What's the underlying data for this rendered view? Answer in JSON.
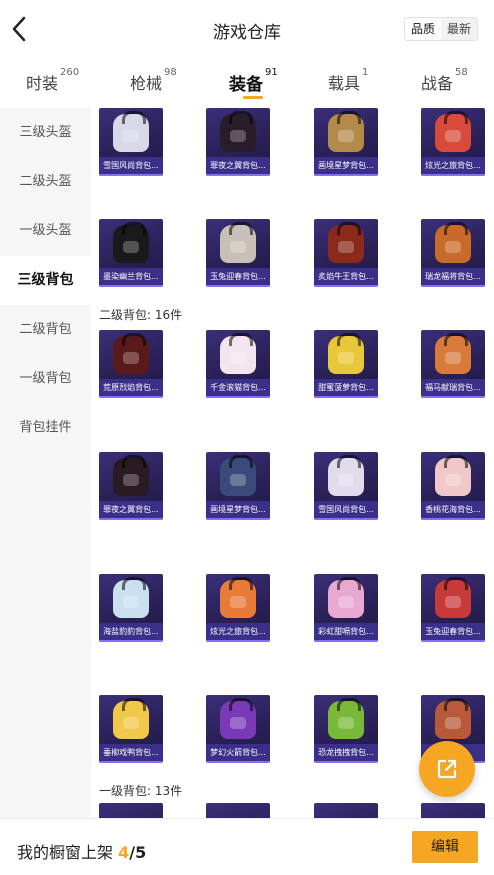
{
  "header": {
    "title": "游戏仓库",
    "sort_options": [
      "品质",
      "最新"
    ],
    "sort_active": "品质"
  },
  "tabs": [
    {
      "label": "时装",
      "count": "260"
    },
    {
      "label": "枪械",
      "count": "98"
    },
    {
      "label": "装备",
      "count": "91",
      "active": true
    },
    {
      "label": "载具",
      "count": "1"
    },
    {
      "label": "战备",
      "count": "58"
    }
  ],
  "sidebar": {
    "items": [
      {
        "label": "三级头盔"
      },
      {
        "label": "二级头盔"
      },
      {
        "label": "一级头盔"
      },
      {
        "label": "三级背包",
        "active": true
      },
      {
        "label": "二级背包"
      },
      {
        "label": "一级背包"
      },
      {
        "label": "背包挂件"
      }
    ]
  },
  "sections": {
    "level2_label": "二级背包: 16件",
    "level1_label": "一级背包: 13件"
  },
  "items_level3": [
    {
      "name": "雪国风尚背包...",
      "color": "#d8d8e8"
    },
    {
      "name": "罪夜之翼背包...",
      "color": "#2a1d2a"
    },
    {
      "name": "画境星梦背包...",
      "color": "#b48a4a"
    },
    {
      "name": "炫光之旅背包...",
      "color": "#d84a3a"
    },
    {
      "name": "墨染幽兰背包...",
      "color": "#1a1a1a"
    },
    {
      "name": "玉兔迎春背包...",
      "color": "#c8c0b8"
    },
    {
      "name": "炙焰牛王背包...",
      "color": "#8a2a1a"
    },
    {
      "name": "瑞龙福将背包...",
      "color": "#c86a2a"
    }
  ],
  "items_level2": [
    {
      "name": "荒原烈焰背包...",
      "color": "#5a1a1a"
    },
    {
      "name": "千金滚猫背包...",
      "color": "#f4e4ee"
    },
    {
      "name": "甜蜜菠萝背包...",
      "color": "#e8c83a"
    },
    {
      "name": "福马献瑞背包...",
      "color": "#d87a3a"
    },
    {
      "name": "罪夜之翼背包...",
      "color": "#2a1a22"
    },
    {
      "name": "画境星梦背包...",
      "color": "#3a4a7a"
    },
    {
      "name": "雪国风尚背包...",
      "color": "#e0dcec"
    },
    {
      "name": "香桃花海背包...",
      "color": "#f0c8c8"
    },
    {
      "name": "海盐豹豹背包...",
      "color": "#c8e0f0"
    },
    {
      "name": "炫光之旅背包...",
      "color": "#e87a3a"
    },
    {
      "name": "彩虹甜嗝背包...",
      "color": "#e8a8d0"
    },
    {
      "name": "玉兔迎春背包...",
      "color": "#c83a3a"
    },
    {
      "name": "垂柳戏鸭背包...",
      "color": "#f0c84a"
    },
    {
      "name": "梦幻火箭背包...",
      "color": "#7a3ab8"
    },
    {
      "name": "恐龙拽拽背包...",
      "color": "#7ab83a"
    },
    {
      "name": "",
      "color": "#b85a3a"
    }
  ],
  "bottom_bar": {
    "label": "我的橱窗上架",
    "count": "4",
    "total": "/5",
    "edit_label": "编辑"
  },
  "colors": {
    "accent": "#f5a623",
    "card_bg": "#2a2056",
    "card_caption": "#3c328c"
  }
}
